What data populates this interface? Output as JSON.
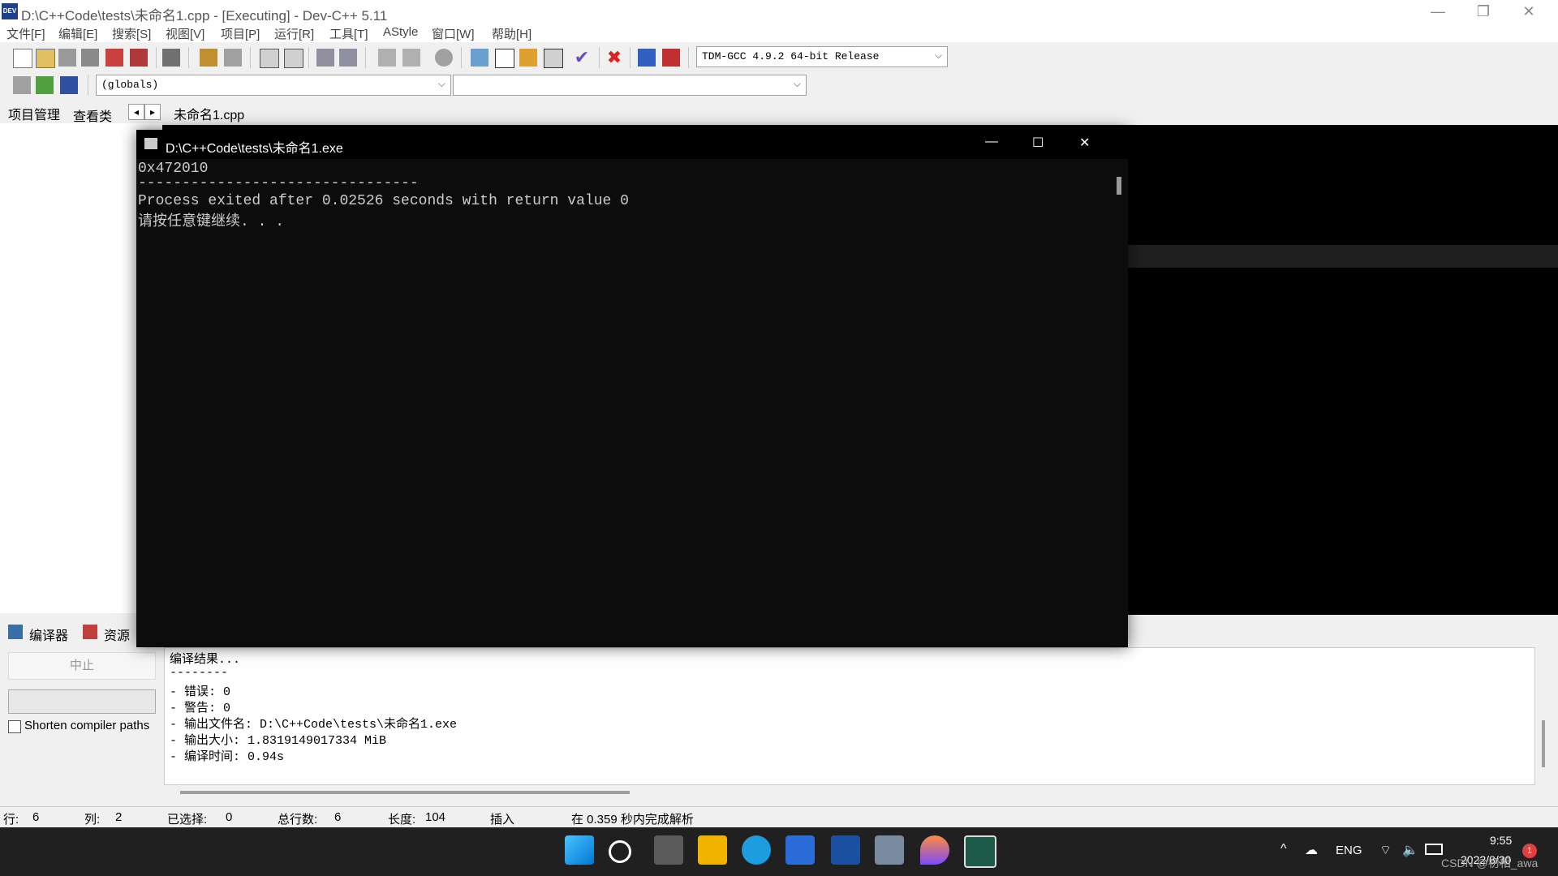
{
  "title_bar": {
    "app_icon_text": "DEV",
    "title": "D:\\C++Code\\tests\\未命名1.cpp - [Executing] - Dev-C++ 5.11",
    "minimize": "—",
    "restore": "❐",
    "close": "✕"
  },
  "menu": [
    "文件[F]",
    "编辑[E]",
    "搜索[S]",
    "视图[V]",
    "项目[P]",
    "运行[R]",
    "工具[T]",
    "AStyle",
    "窗口[W]",
    "帮助[H]"
  ],
  "toolbar": {
    "compiler_select": "TDM-GCC 4.9.2 64-bit Release",
    "globals_select": "(globals)",
    "function_select": ""
  },
  "left_tabs": [
    "项目管理",
    "查看类"
  ],
  "editor": {
    "file_tab": "未命名1.cpp",
    "nav_left": "◂",
    "nav_right": "▸"
  },
  "bottom_tabs": [
    "编译器",
    "资源"
  ],
  "bottom_left": {
    "stop_button": "中止",
    "shorten_paths_label": "Shorten compiler paths"
  },
  "compile_output": [
    "编译结果...",
    "--------",
    "- 错误: 0",
    "- 警告: 0",
    "- 输出文件名: D:\\C++Code\\tests\\未命名1.exe",
    "- 输出大小: 1.8319149017334 MiB",
    "- 编译时间: 0.94s"
  ],
  "status": {
    "row_label": "行:",
    "row": "6",
    "col_label": "列:",
    "col": "2",
    "sel_label": "已选择:",
    "sel": "0",
    "lines_label": "总行数:",
    "lines": "6",
    "len_label": "长度:",
    "len": "104",
    "mode": "插入",
    "parse": "在 0.359 秒内完成解析"
  },
  "console": {
    "title": "D:\\C++Code\\tests\\未命名1.exe",
    "lines": [
      "0x472010",
      "--------------------------------",
      "Process exited after 0.02526 seconds with return value 0",
      "请按任意键继续. . ."
    ],
    "minimize": "—",
    "maximize": "☐",
    "close": "✕"
  },
  "taskbar": {
    "lang": "ENG",
    "time": "9:55",
    "date": "2022/8/30",
    "notification_count": "1",
    "watermark": "CSDN @初相_awa"
  }
}
